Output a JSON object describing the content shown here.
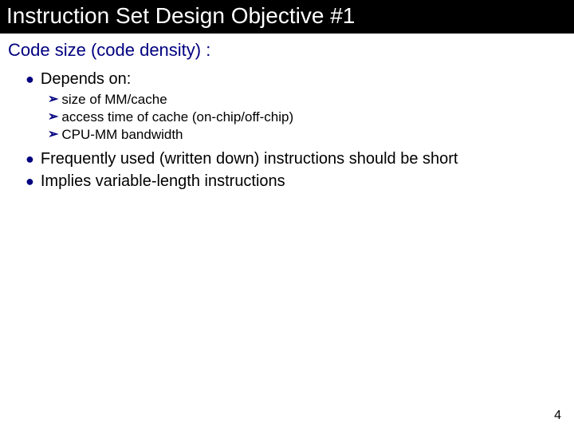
{
  "title": "Instruction Set Design Objective #1",
  "heading": "Code size (code density) :",
  "bullets": [
    {
      "text": "Depends on:"
    },
    {
      "text": "Frequently used (written down) instructions should be short"
    },
    {
      "text": "Implies variable-length instructions"
    }
  ],
  "sub_bullets": [
    {
      "text": "size of MM/cache"
    },
    {
      "text": "access time of cache (on-chip/off-chip)"
    },
    {
      "text": "CPU-MM bandwidth"
    }
  ],
  "page_number": "4"
}
